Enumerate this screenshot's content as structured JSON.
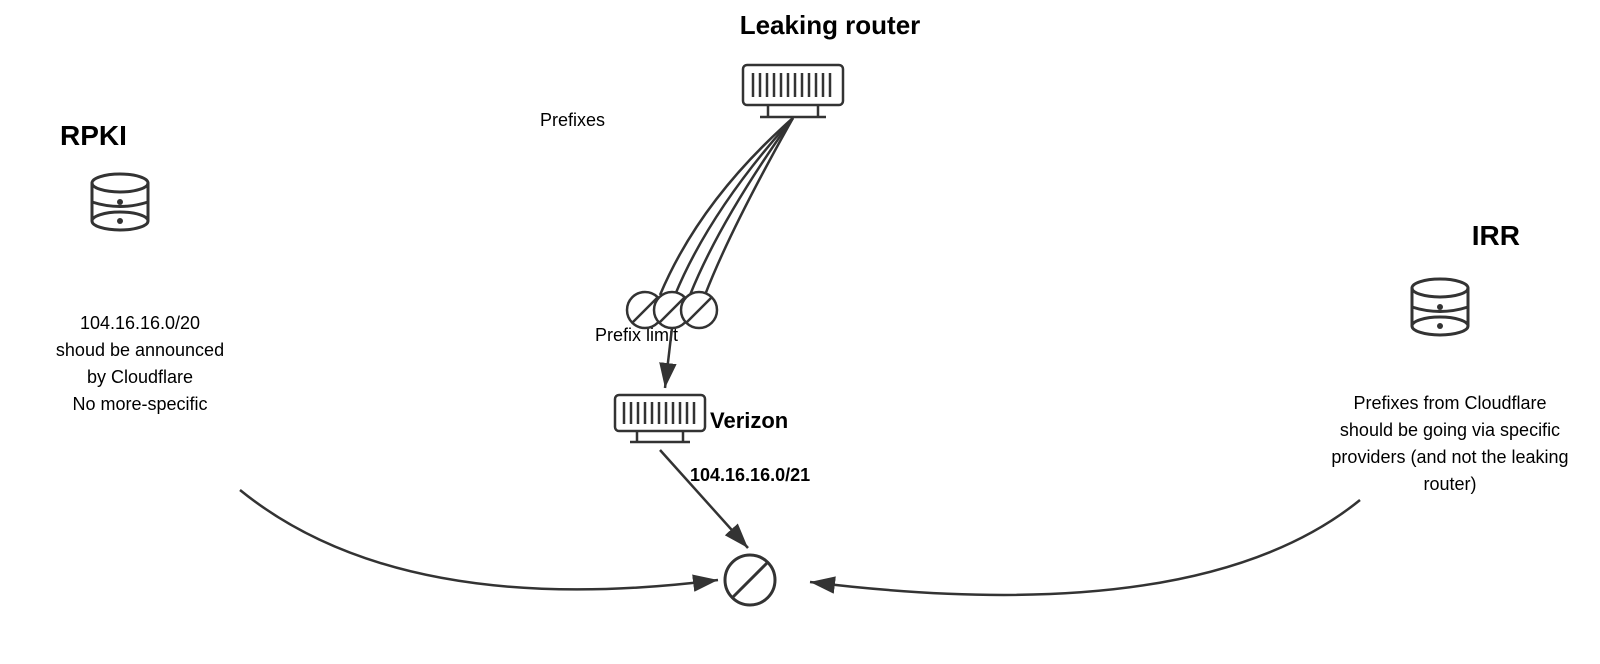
{
  "diagram": {
    "leaking_router": {
      "label": "Leaking router"
    },
    "rpki": {
      "label": "RPKI",
      "description": "104.16.16.0/20\nshoud be announced\nby Cloudflare\nNo more-specific"
    },
    "irr": {
      "label": "IRR",
      "description": "Prefixes from Cloudflare\nshould be going via specific\nproviders (and not the leaking\nrouter)"
    },
    "verizon": {
      "label": "Verizon"
    },
    "prefixes_label": "Prefixes",
    "prefix_limit_label": "Prefix limit",
    "prefix_announce": "104.16.16.0/21"
  }
}
